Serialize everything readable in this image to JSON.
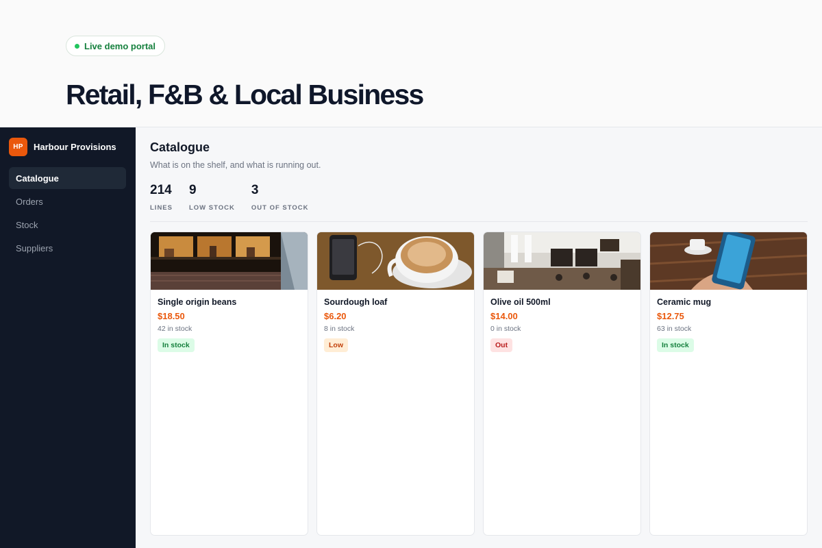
{
  "hero": {
    "badge": "Live demo portal",
    "title": "Retail, F&B & Local Business"
  },
  "sidebar": {
    "brand_initials": "HP",
    "brand_name": "Harbour Provisions",
    "items": [
      {
        "label": "Catalogue",
        "active": true
      },
      {
        "label": "Orders",
        "active": false
      },
      {
        "label": "Stock",
        "active": false
      },
      {
        "label": "Suppliers",
        "active": false
      }
    ]
  },
  "main": {
    "title": "Catalogue",
    "subtitle": "What is on the shelf, and what is running out.",
    "stats": [
      {
        "value": "214",
        "label": "LINES"
      },
      {
        "value": "9",
        "label": "LOW STOCK"
      },
      {
        "value": "3",
        "label": "OUT OF STOCK"
      }
    ],
    "products": [
      {
        "name": "Single origin beans",
        "price": "$18.50",
        "stock": "42 in stock",
        "status": "In stock",
        "status_kind": "ok",
        "image": "cafe-window-photo"
      },
      {
        "name": "Sourdough loaf",
        "price": "$6.20",
        "stock": "8 in stock",
        "status": "Low",
        "status_kind": "low",
        "image": "coffee-cup-phone-photo"
      },
      {
        "name": "Olive oil 500ml",
        "price": "$14.00",
        "stock": "0 in stock",
        "status": "Out",
        "status_kind": "out",
        "image": "cafe-interior-photo"
      },
      {
        "name": "Ceramic mug",
        "price": "$12.75",
        "stock": "63 in stock",
        "status": "In stock",
        "status_kind": "ok",
        "image": "hand-phone-table-photo"
      }
    ]
  },
  "colors": {
    "accent": "#ea580c",
    "sidebar_bg": "#111827",
    "ok": "#15803d",
    "low": "#c2410c",
    "out": "#b91c1c"
  }
}
